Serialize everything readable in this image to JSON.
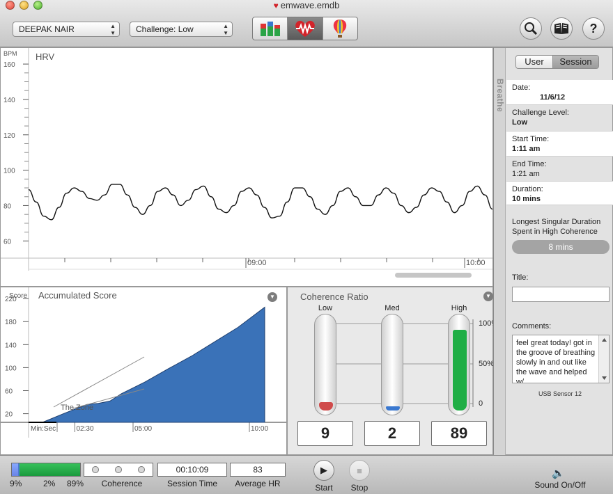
{
  "window": {
    "title": "emwave.emdb"
  },
  "toolbar": {
    "user_select": "DEEPAK NAIR",
    "challenge_select": "Challenge: Low",
    "view_modes": [
      "bar-chart-icon",
      "heart-wave-icon",
      "balloon-icon"
    ],
    "active_view": 1,
    "search_icon": "search-icon",
    "book_icon": "book-icon",
    "help_icon": "help-icon"
  },
  "hrv": {
    "title": "HRV",
    "unit": "BPM",
    "y_ticks": [
      "160",
      "140",
      "120",
      "100",
      "80",
      "60"
    ],
    "x_ticks": [
      "09:00",
      "10:00"
    ]
  },
  "score": {
    "title": "Accumulated Score",
    "unit": "Score",
    "y_ticks": [
      "220",
      "180",
      "140",
      "100",
      "60",
      "20"
    ],
    "x_ticks": [
      "Min:Sec",
      "02:30",
      "05:00",
      "10:00"
    ],
    "zone_label": "The Zone"
  },
  "coherence": {
    "title": "Coherence Ratio",
    "levels": [
      {
        "label": "Low",
        "value": "9",
        "percent": 9,
        "color": "#d04b4b"
      },
      {
        "label": "Med",
        "value": "2",
        "percent": 2,
        "color": "#3a78d0"
      },
      {
        "label": "High",
        "value": "89",
        "percent": 89,
        "color": "#1fae45"
      }
    ],
    "scale": [
      "100%",
      "50%",
      "0"
    ]
  },
  "side": {
    "tabs": [
      "User",
      "Session"
    ],
    "active_tab": 1,
    "breathe_label": "Breathe",
    "date_label": "Date:",
    "date_value": "11/6/12",
    "challenge_label": "Challenge Level:",
    "challenge_value": "Low",
    "start_label": "Start Time:",
    "start_value": "1:11 am",
    "end_label": "End Time:",
    "end_value": "1:21 am",
    "duration_label": "Duration:",
    "duration_value": "10 mins",
    "longest_label": "Longest Singular Duration Spent in High Coherence",
    "longest_value": "8 mins",
    "title_label": "Title:",
    "title_value": "",
    "comments_label": "Comments:",
    "comments_value": "feel great today! got in the groove of breathing slowly in and out like the wave and helped w/",
    "sensor": "USB Sensor 12"
  },
  "bottom": {
    "pct_low": "9%",
    "pct_med": "2%",
    "pct_high": "89%",
    "coherence_label": "Coherence",
    "session_time": "00:10:09",
    "session_time_label": "Session Time",
    "avg_hr": "83",
    "avg_hr_label": "Average HR",
    "start_label": "Start",
    "stop_label": "Stop",
    "sound_label": "Sound On/Off"
  },
  "chart_data": [
    {
      "type": "line",
      "title": "HRV",
      "ylabel": "BPM",
      "ylim": [
        55,
        162
      ],
      "x_tick_labels": [
        "09:00",
        "10:00"
      ],
      "series": [
        {
          "values": [
            89,
            82,
            74,
            72,
            79,
            87,
            90,
            88,
            84,
            83,
            86,
            92,
            92,
            86,
            79,
            75,
            80,
            88,
            90,
            86,
            80,
            83,
            89,
            91,
            85,
            78,
            76,
            80,
            88,
            90,
            86,
            79,
            73,
            74,
            82,
            90,
            90,
            85,
            78,
            75,
            80,
            88,
            90,
            85,
            80,
            80,
            86,
            90,
            87,
            80,
            76,
            79,
            86,
            90,
            88,
            82,
            76,
            80,
            88,
            91,
            86,
            78
          ]
        }
      ]
    },
    {
      "type": "area",
      "title": "Accumulated Score",
      "ylabel": "Score",
      "xlabel": "Min:Sec",
      "ylim": [
        5,
        225
      ],
      "x": [
        0,
        0.6,
        1.5,
        2.0,
        2.5,
        3.0,
        3.5,
        4.0,
        5.0,
        6.0,
        7.0,
        8.0,
        9.0,
        10.15
      ],
      "values": [
        5,
        5,
        20,
        28,
        36,
        38,
        42,
        55,
        75,
        98,
        120,
        145,
        170,
        205
      ],
      "x_tick_labels": [
        "02:30",
        "05:00",
        "10:00"
      ],
      "annotation": "The Zone"
    }
  ]
}
